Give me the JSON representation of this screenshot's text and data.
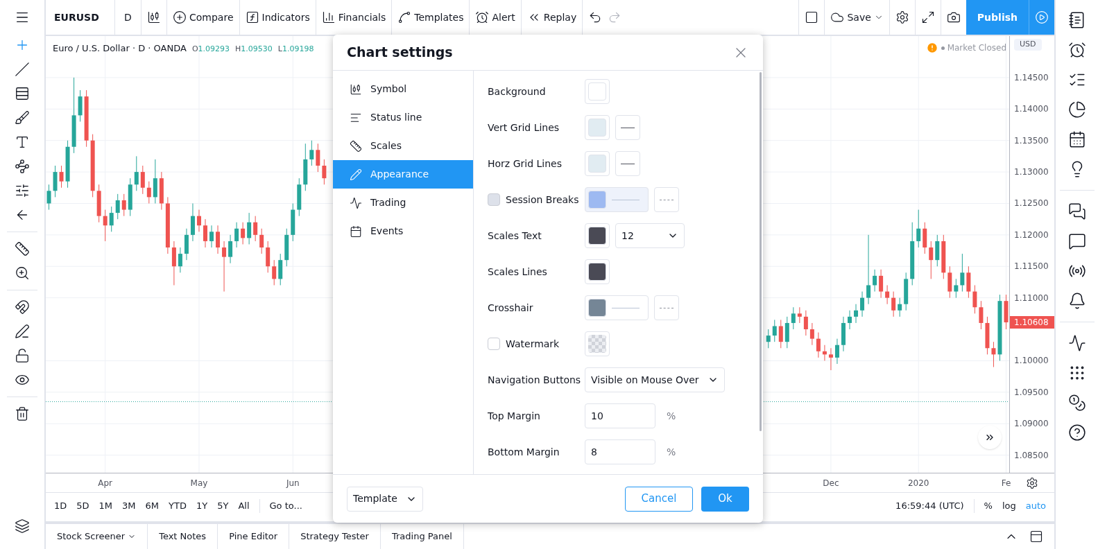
{
  "left_tools": [
    {
      "selected": true
    },
    {
      "selected": false
    },
    {
      "selected": false
    },
    {
      "selected": false
    },
    {
      "selected": false
    },
    {
      "selected": false
    },
    {
      "selected": false
    },
    {
      "selected": false
    },
    {
      "selected": false
    },
    {
      "selected": false
    },
    {
      "selected": false
    },
    {
      "selected": false
    },
    {
      "selected": false
    },
    {
      "selected": false
    },
    {
      "selected": false
    }
  ],
  "top_toolbar": {
    "symbol": "EURUSD",
    "interval": "D",
    "buttons": [
      {
        "kind": "compare",
        "label": "Compare"
      },
      {
        "kind": "indicators",
        "label": "Indicators"
      },
      {
        "kind": "financials",
        "label": "Financials"
      },
      {
        "kind": "templates",
        "label": "Templates"
      },
      {
        "kind": "alert",
        "label": "Alert"
      },
      {
        "kind": "replay",
        "label": "Replay"
      }
    ],
    "save": "Save",
    "publish": "Publish"
  },
  "legend": {
    "title": "Euro / U.S. Dollar · D · OANDA",
    "values": [
      {
        "prefix": "O",
        "value": "1.09293"
      },
      {
        "prefix": "H",
        "value": "1.09530"
      },
      {
        "prefix": "L",
        "value": "1.09198"
      }
    ]
  },
  "market_status": "Market Closed",
  "currency": "USD",
  "last_price": "1.10608",
  "chart_data": {
    "type": "candlestick",
    "grid": true,
    "ylim": [
      1.0822,
      1.1516
    ],
    "ref_lines": [
      {
        "axis": "y",
        "value": 1.0935,
        "color": "#26a69a"
      }
    ],
    "categories": [
      null,
      null,
      null,
      null,
      null,
      null,
      null,
      null,
      null,
      "Apr",
      null,
      null,
      null,
      null,
      null,
      null,
      null,
      null,
      null,
      null,
      null,
      null,
      null,
      null,
      "May",
      null,
      null,
      null,
      null,
      null,
      null,
      null,
      null,
      null,
      null,
      null,
      null,
      null,
      null,
      "Jun",
      null,
      null,
      null,
      null,
      null,
      null,
      null,
      null,
      null,
      null,
      null,
      null,
      null,
      null,
      null,
      null,
      null,
      null,
      null,
      null,
      null,
      null,
      null,
      null,
      null,
      null,
      null,
      null,
      null,
      null,
      null,
      null,
      null,
      null,
      null,
      null,
      null,
      null,
      null,
      null,
      null,
      null,
      null,
      null,
      null,
      null,
      null,
      null,
      null,
      null,
      null,
      null,
      null,
      null,
      null,
      null,
      null,
      null,
      null,
      null,
      null,
      null,
      null,
      null,
      null,
      null,
      null,
      null,
      null,
      null,
      null,
      null,
      null,
      null,
      null,
      null,
      null,
      null,
      null,
      null,
      null,
      null,
      null,
      null,
      null,
      "Dec",
      null,
      null,
      null,
      null,
      null,
      null,
      null,
      null,
      null,
      null,
      null,
      null,
      null,
      "2020",
      null,
      null,
      null,
      null,
      null,
      null,
      null,
      null,
      null,
      null,
      null,
      null,
      null,
      "Fe"
    ],
    "ohlc": [
      [
        1.125,
        1.128,
        1.124,
        1.127
      ],
      [
        1.127,
        1.131,
        1.126,
        1.13
      ],
      [
        1.13,
        1.131,
        1.1275,
        1.1285
      ],
      [
        1.1285,
        1.135,
        1.1275,
        1.134
      ],
      [
        1.134,
        1.145,
        1.133,
        1.139
      ],
      [
        1.139,
        1.143,
        1.138,
        1.142
      ],
      [
        1.142,
        1.143,
        1.134,
        1.135
      ],
      [
        1.135,
        1.136,
        1.126,
        1.127
      ],
      [
        1.127,
        1.128,
        1.122,
        1.123
      ],
      [
        1.123,
        1.124,
        1.119,
        1.1215
      ],
      [
        1.1215,
        1.1245,
        1.1205,
        1.1235
      ],
      [
        1.1235,
        1.1265,
        1.1225,
        1.1255
      ],
      [
        1.1255,
        1.1265,
        1.123,
        1.124
      ],
      [
        1.124,
        1.129,
        1.123,
        1.128
      ],
      [
        1.128,
        1.1325,
        1.127,
        1.13
      ],
      [
        1.13,
        1.131,
        1.1265,
        1.1275
      ],
      [
        1.1275,
        1.1285,
        1.125,
        1.126
      ],
      [
        1.126,
        1.132,
        1.125,
        1.129
      ],
      [
        1.129,
        1.13,
        1.124,
        1.125
      ],
      [
        1.125,
        1.126,
        1.117,
        1.118
      ],
      [
        1.118,
        1.119,
        1.112,
        1.115
      ],
      [
        1.115,
        1.118,
        1.114,
        1.117
      ],
      [
        1.117,
        1.121,
        1.116,
        1.12
      ],
      [
        1.12,
        1.125,
        1.119,
        1.123
      ],
      [
        1.123,
        1.124,
        1.1205,
        1.1215
      ],
      [
        1.1215,
        1.1225,
        1.118,
        1.119
      ],
      [
        1.119,
        1.1215,
        1.118,
        1.1205
      ],
      [
        1.1205,
        1.1215,
        1.117,
        1.118
      ],
      [
        1.118,
        1.119,
        1.111,
        1.1165
      ],
      [
        1.1165,
        1.12,
        1.1155,
        1.119
      ],
      [
        1.119,
        1.122,
        1.118,
        1.121
      ],
      [
        1.121,
        1.122,
        1.1185,
        1.1195
      ],
      [
        1.1195,
        1.1235,
        1.1185,
        1.122
      ],
      [
        1.122,
        1.123,
        1.119,
        1.12
      ],
      [
        1.12,
        1.121,
        1.117,
        1.118
      ],
      [
        1.118,
        1.119,
        1.114,
        1.115
      ],
      [
        1.115,
        1.116,
        1.112,
        1.113
      ],
      [
        1.113,
        1.117,
        1.112,
        1.116
      ],
      [
        1.116,
        1.121,
        1.115,
        1.12
      ],
      [
        1.12,
        1.125,
        1.119,
        1.124
      ],
      [
        1.124,
        1.129,
        1.123,
        1.128
      ],
      [
        1.128,
        1.1345,
        1.127,
        1.132
      ],
      [
        1.132,
        1.135,
        1.131,
        1.1335
      ],
      [
        1.1335,
        1.1345,
        1.13,
        1.131
      ],
      [
        1.131,
        1.132,
        1.128,
        1.129
      ],
      null,
      null,
      null,
      null,
      null,
      null,
      null,
      null,
      null,
      null,
      null,
      null,
      null,
      null,
      null,
      null,
      null,
      null,
      null,
      null,
      null,
      null,
      null,
      null,
      null,
      null,
      null,
      null,
      null,
      null,
      null,
      null,
      null,
      null,
      null,
      null,
      null,
      null,
      null,
      null,
      null,
      null,
      null,
      null,
      null,
      null,
      null,
      null,
      null,
      null,
      null,
      null,
      null,
      null,
      null,
      null,
      null,
      null,
      null,
      null,
      null,
      null,
      null,
      null,
      null,
      null,
      null,
      null,
      null,
      null,
      [
        1.103,
        1.105,
        1.102,
        1.104
      ],
      [
        1.104,
        1.1065,
        1.103,
        1.1055
      ],
      [
        1.1055,
        1.1065,
        1.102,
        1.103
      ],
      [
        1.103,
        1.107,
        1.102,
        1.106
      ],
      [
        1.106,
        1.1085,
        1.105,
        1.1075
      ],
      [
        1.1075,
        1.1085,
        1.106,
        1.107
      ],
      [
        1.107,
        1.108,
        1.104,
        1.105
      ],
      [
        1.105,
        1.106,
        1.1025,
        1.1035
      ],
      [
        1.1035,
        1.1045,
        1.1005,
        1.1015
      ],
      [
        1.1015,
        1.1025,
        1.1,
        1.101
      ],
      [
        1.101,
        1.102,
        1.0985,
        1.1005
      ],
      [
        1.1005,
        1.1035,
        1.0995,
        1.1025
      ],
      [
        1.1025,
        1.107,
        1.1015,
        1.106
      ],
      [
        1.106,
        1.108,
        1.105,
        1.107
      ],
      [
        1.107,
        1.109,
        1.106,
        1.108
      ],
      [
        1.108,
        1.111,
        1.107,
        1.11
      ],
      [
        1.11,
        1.12,
        1.109,
        1.112
      ],
      [
        1.112,
        1.1145,
        1.111,
        1.1135
      ],
      [
        1.1135,
        1.1145,
        1.11,
        1.111
      ],
      [
        1.111,
        1.112,
        1.109,
        1.11
      ],
      [
        1.11,
        1.111,
        1.107,
        1.108
      ],
      [
        1.108,
        1.11,
        1.107,
        1.109
      ],
      [
        1.109,
        1.114,
        1.108,
        1.113
      ],
      [
        1.113,
        1.122,
        1.112,
        1.119
      ],
      [
        1.119,
        1.124,
        1.118,
        1.121
      ],
      [
        1.121,
        1.122,
        1.117,
        1.118
      ],
      [
        1.118,
        1.119,
        1.113,
        1.116
      ],
      [
        1.116,
        1.12,
        1.115,
        1.119
      ],
      [
        1.119,
        1.12,
        1.113,
        1.114
      ],
      [
        1.114,
        1.115,
        1.11,
        1.111
      ],
      [
        1.111,
        1.113,
        1.11,
        1.112
      ],
      [
        1.112,
        1.117,
        1.111,
        1.114
      ],
      [
        1.114,
        1.115,
        1.11,
        1.111
      ],
      [
        1.111,
        1.112,
        1.1075,
        1.1085
      ],
      [
        1.1085,
        1.1095,
        1.105,
        1.106
      ],
      [
        1.106,
        1.107,
        1.101,
        1.102
      ],
      [
        1.102,
        1.103,
        1.099,
        1.101
      ],
      [
        1.101,
        1.1105,
        1.1,
        1.1095
      ],
      [
        1.1095,
        1.1105,
        1.105,
        1.1061
      ]
    ],
    "yticks": [
      {
        "value": 1.145,
        "label": "1.14500"
      },
      {
        "value": 1.14,
        "label": "1.14000"
      },
      {
        "value": 1.135,
        "label": "1.13500"
      },
      {
        "value": 1.13,
        "label": "1.13000"
      },
      {
        "value": 1.125,
        "label": "1.12500"
      },
      {
        "value": 1.12,
        "label": "1.12000"
      },
      {
        "value": 1.115,
        "label": "1.11500"
      },
      {
        "value": 1.11,
        "label": "1.11000"
      },
      {
        "value": 1.1,
        "label": "1.10000"
      },
      {
        "value": 1.095,
        "label": "1.09500"
      },
      {
        "value": 1.09,
        "label": "1.09000"
      },
      {
        "value": 1.085,
        "label": "1.08500"
      }
    ]
  },
  "range_bar": {
    "ranges": [
      "1D",
      "5D",
      "1M",
      "3M",
      "6M",
      "YTD",
      "1Y",
      "5Y",
      "All"
    ],
    "goto": "Go to...",
    "clock": "16:59:44 (UTC)",
    "scale_options": [
      {
        "label": "%",
        "selected": false
      },
      {
        "label": "log",
        "selected": false
      },
      {
        "label": "auto",
        "selected": true
      }
    ]
  },
  "bottom_tabs": [
    {
      "label": "Stock Screener",
      "has_menu": true
    },
    {
      "label": "Text Notes",
      "has_menu": false
    },
    {
      "label": "Pine Editor",
      "has_menu": false
    },
    {
      "label": "Strategy Tester",
      "has_menu": false
    },
    {
      "label": "Trading Panel",
      "has_menu": false
    }
  ],
  "dialog": {
    "title": "Chart settings",
    "nav": [
      {
        "label": "Symbol",
        "selected": false
      },
      {
        "label": "Status line",
        "selected": false
      },
      {
        "label": "Scales",
        "selected": false
      },
      {
        "label": "Appearance",
        "selected": true
      },
      {
        "label": "Trading",
        "selected": false
      },
      {
        "label": "Events",
        "selected": false
      }
    ],
    "rows": [
      {
        "kind": "color",
        "label": "Background",
        "swatch": {
          "color": "#ffffff"
        }
      },
      {
        "kind": "color",
        "label": "Vert Grid Lines",
        "swatch": {
          "color": "#e1ecf2"
        },
        "style_button": {
          "dashed": false
        }
      },
      {
        "kind": "color",
        "label": "Horz Grid Lines",
        "swatch": {
          "color": "#e1ecf2"
        },
        "style_button": {
          "dashed": false
        }
      },
      {
        "kind": "check_color",
        "label": "Session Breaks",
        "checked": false,
        "disabled": true,
        "swatch": {
          "color": "#9db9f1",
          "with_line": true
        },
        "style_button": {
          "dashed": true
        }
      },
      {
        "kind": "color",
        "label": "Scales Text",
        "swatch": {
          "color": "#4a4a55"
        },
        "select": "12"
      },
      {
        "kind": "color",
        "label": "Scales Lines",
        "swatch": {
          "color": "#4a4a55"
        }
      },
      {
        "kind": "color",
        "label": "Crosshair",
        "swatch": {
          "color": "#758696",
          "with_line": true
        },
        "style_button": {
          "dashed": true
        }
      },
      {
        "kind": "check_color",
        "label": "Watermark",
        "checked": false,
        "disabled": false,
        "swatch": {
          "checkered": true
        }
      },
      {
        "kind": "select",
        "label": "Navigation Buttons",
        "value": "Visible on Mouse Over"
      },
      {
        "kind": "number",
        "label": "Top Margin",
        "value": "10",
        "unit": "%"
      },
      {
        "kind": "number",
        "label": "Bottom Margin",
        "value": "8",
        "unit": "%"
      }
    ],
    "template": "Template",
    "cancel": "Cancel",
    "ok": "Ok"
  }
}
